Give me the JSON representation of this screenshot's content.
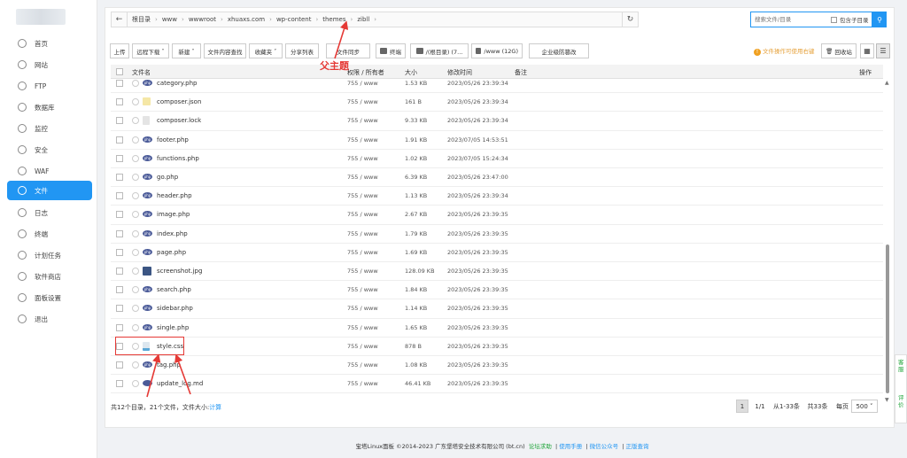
{
  "sidebar": {
    "items": [
      {
        "label": "首页",
        "icon": "home-icon"
      },
      {
        "label": "网站",
        "icon": "globe-icon"
      },
      {
        "label": "FTP",
        "icon": "ftp-icon"
      },
      {
        "label": "数据库",
        "icon": "database-icon"
      },
      {
        "label": "监控",
        "icon": "monitor-icon"
      },
      {
        "label": "安全",
        "icon": "shield-icon"
      },
      {
        "label": "WAF",
        "icon": "waf-icon"
      },
      {
        "label": "文件",
        "icon": "folder-icon",
        "active": true
      },
      {
        "label": "日志",
        "icon": "log-icon"
      },
      {
        "label": "终端",
        "icon": "terminal-icon"
      },
      {
        "label": "计划任务",
        "icon": "clock-icon"
      },
      {
        "label": "软件商店",
        "icon": "store-icon"
      },
      {
        "label": "面板设置",
        "icon": "settings-icon"
      },
      {
        "label": "退出",
        "icon": "logout-icon"
      }
    ]
  },
  "path": {
    "crumbs": [
      "根目录",
      "www",
      "wwwroot",
      "xhuaxs.com",
      "wp-content",
      "themes",
      "zibll"
    ]
  },
  "search": {
    "placeholder": "搜索文件/目录",
    "include_sub_label": "包含子目录"
  },
  "toolbar": {
    "upload": "上传",
    "remote_download": "远程下载",
    "new": "新建",
    "content_search": "文件内容查找",
    "favorites": "收藏夹",
    "share_list": "分享列表",
    "file_sync": "文件同步",
    "terminal": "终端",
    "disk_root": "/(根目录) (7...",
    "disk_www": "/www (12G)",
    "tamper": "企业级防篡改",
    "warning": "文件操作可使用右键",
    "recycle": "回收站"
  },
  "table": {
    "headers": {
      "name": "文件名",
      "perm": "权限 / 所有者",
      "size": "大小",
      "time": "修改时间",
      "note": "备注",
      "actions": "操作"
    },
    "rows": [
      {
        "name": "category.php",
        "type": "php",
        "perm": "755 / www",
        "size": "1.53 KB",
        "time": "2023/05/26 23:39:34"
      },
      {
        "name": "composer.json",
        "type": "json",
        "perm": "755 / www",
        "size": "161 B",
        "time": "2023/05/26 23:39:34"
      },
      {
        "name": "composer.lock",
        "type": "lock",
        "perm": "755 / www",
        "size": "9.33 KB",
        "time": "2023/05/26 23:39:34"
      },
      {
        "name": "footer.php",
        "type": "php",
        "perm": "755 / www",
        "size": "1.91 KB",
        "time": "2023/07/05 14:53:51"
      },
      {
        "name": "functions.php",
        "type": "php",
        "perm": "755 / www",
        "size": "1.02 KB",
        "time": "2023/07/05 15:24:34"
      },
      {
        "name": "go.php",
        "type": "php",
        "perm": "755 / www",
        "size": "6.39 KB",
        "time": "2023/05/26 23:47:00"
      },
      {
        "name": "header.php",
        "type": "php",
        "perm": "755 / www",
        "size": "1.13 KB",
        "time": "2023/05/26 23:39:34"
      },
      {
        "name": "image.php",
        "type": "php",
        "perm": "755 / www",
        "size": "2.67 KB",
        "time": "2023/05/26 23:39:35"
      },
      {
        "name": "index.php",
        "type": "php",
        "perm": "755 / www",
        "size": "1.79 KB",
        "time": "2023/05/26 23:39:35"
      },
      {
        "name": "page.php",
        "type": "php",
        "perm": "755 / www",
        "size": "1.69 KB",
        "time": "2023/05/26 23:39:35"
      },
      {
        "name": "screenshot.jpg",
        "type": "img",
        "perm": "755 / www",
        "size": "128.09 KB",
        "time": "2023/05/26 23:39:35"
      },
      {
        "name": "search.php",
        "type": "php",
        "perm": "755 / www",
        "size": "1.84 KB",
        "time": "2023/05/26 23:39:35"
      },
      {
        "name": "sidebar.php",
        "type": "php",
        "perm": "755 / www",
        "size": "1.14 KB",
        "time": "2023/05/26 23:39:35"
      },
      {
        "name": "single.php",
        "type": "php",
        "perm": "755 / www",
        "size": "1.65 KB",
        "time": "2023/05/26 23:39:35"
      },
      {
        "name": "style.css",
        "type": "css",
        "perm": "755 / www",
        "size": "878 B",
        "time": "2023/05/26 23:39:35"
      },
      {
        "name": "tag.php",
        "type": "php",
        "perm": "755 / www",
        "size": "1.08 KB",
        "time": "2023/05/26 23:39:35"
      },
      {
        "name": "update_log.md",
        "type": "md",
        "perm": "755 / www",
        "size": "46.41 KB",
        "time": "2023/05/26 23:39:35"
      }
    ]
  },
  "summary": {
    "text": "共12个目录，21个文件，文件大小:",
    "calc": "计算"
  },
  "pager": {
    "current": "1",
    "total_pages": "1/1",
    "range": "从1-33条",
    "count": "共33条",
    "per_page_label": "每页",
    "per_page": "500"
  },
  "annotation": {
    "label": "父主题",
    "color": "#e53935"
  },
  "float": {
    "service": "客服",
    "feedback": "评价"
  },
  "footer": {
    "copyright": "宝塔Linux面板 ©2014-2023 广东堡塔安全技术有限公司 (bt.cn)",
    "forum": "论坛求助",
    "manual": "使用手册",
    "wechat": "微信公众号",
    "verify": "正版查询"
  },
  "colors": {
    "accent": "#2196f3",
    "annotation": "#e53935",
    "green": "#20a53a"
  }
}
